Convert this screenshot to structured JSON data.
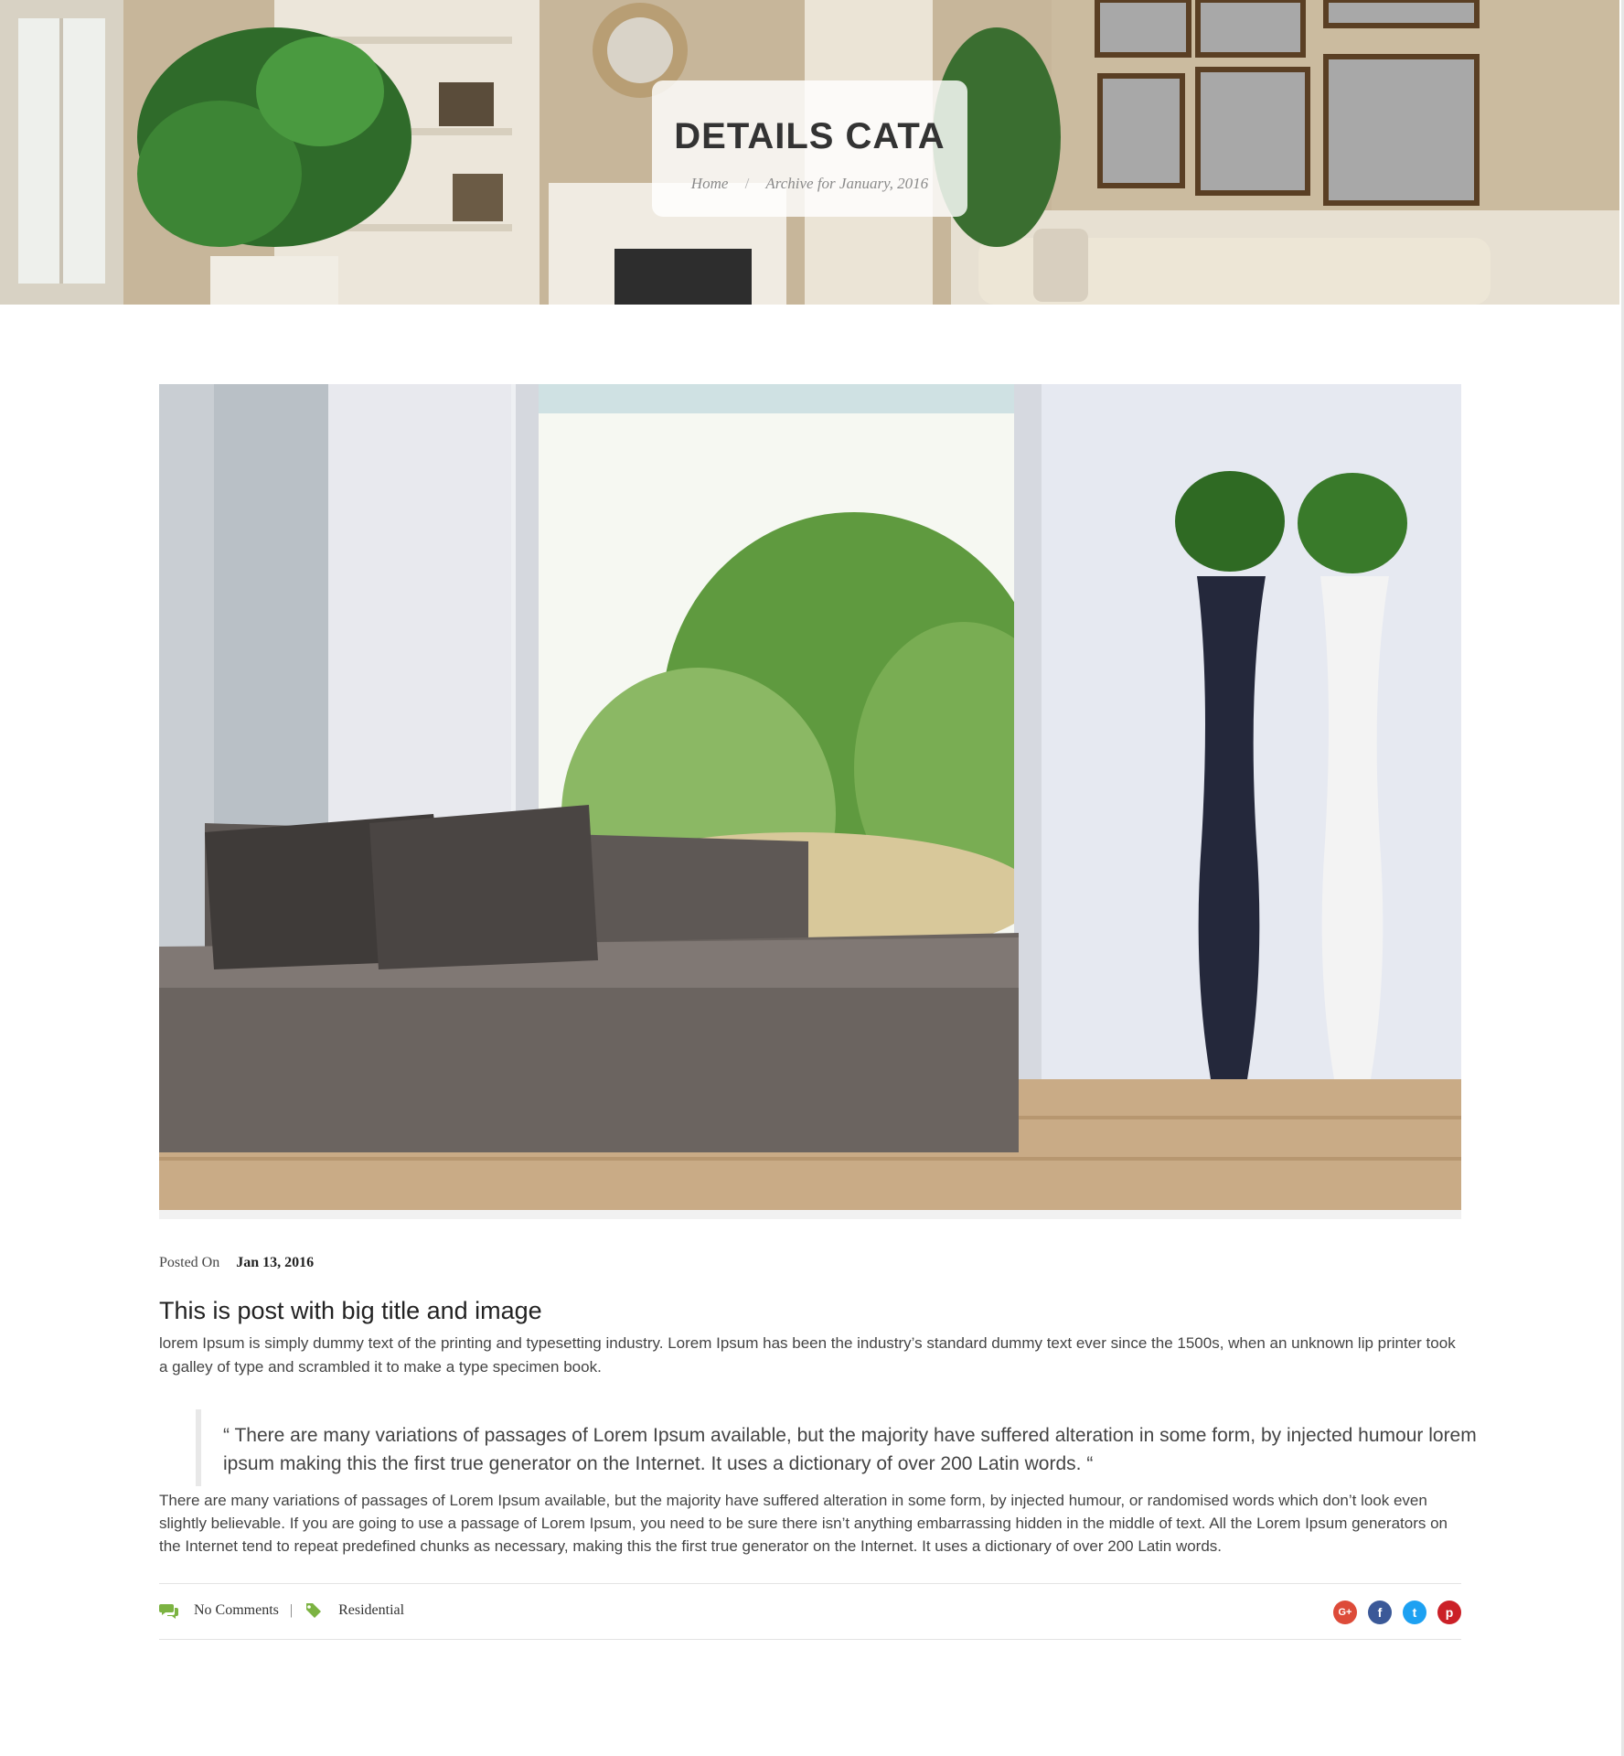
{
  "hero": {
    "title": "DETAILS CATA",
    "breadcrumb": {
      "home": "Home",
      "separator": "/",
      "current": "Archive for January, 2016"
    }
  },
  "post": {
    "posted_on_label": "Posted On",
    "date": "Jan 13, 2016",
    "title": "This is post with big title and image",
    "intro": "lorem Ipsum is simply dummy text of the printing and typesetting industry. Lorem Ipsum has been the industry’s standard dummy text ever since the 1500s, when an unknown lip printer took a galley of type and scrambled it to make a type specimen book.",
    "quote": "“ There are many variations of passages of Lorem Ipsum available, but the majority have suffered alteration in some form, by injected humour lorem ipsum making this the first true generator on the Internet. It uses a dictionary of over 200 Latin words. “",
    "body": "There are many variations of passages of Lorem Ipsum available, but the majority have suffered alteration in some form, by injected humour, or randomised words which don’t look even slightly believable. If you are going to use a passage of Lorem Ipsum, you need to be sure there isn’t anything embarrassing hidden in the middle of text. All the Lorem Ipsum generators on the Internet tend to repeat predefined chunks as necessary, making this the first true generator on the Internet. It uses a dictionary of over 200 Latin words."
  },
  "footer": {
    "comments": "No Comments",
    "separator": "|",
    "category": "Residential",
    "accent_color": "#7cb342",
    "social": [
      {
        "icon": "google-plus-icon",
        "glyph": "G+",
        "color": "#dd4b39"
      },
      {
        "icon": "facebook-icon",
        "glyph": "f",
        "color": "#3b5998"
      },
      {
        "icon": "twitter-icon",
        "glyph": "t",
        "color": "#1da1f2"
      },
      {
        "icon": "pinterest-icon",
        "glyph": "p",
        "color": "#cb2027"
      }
    ]
  }
}
